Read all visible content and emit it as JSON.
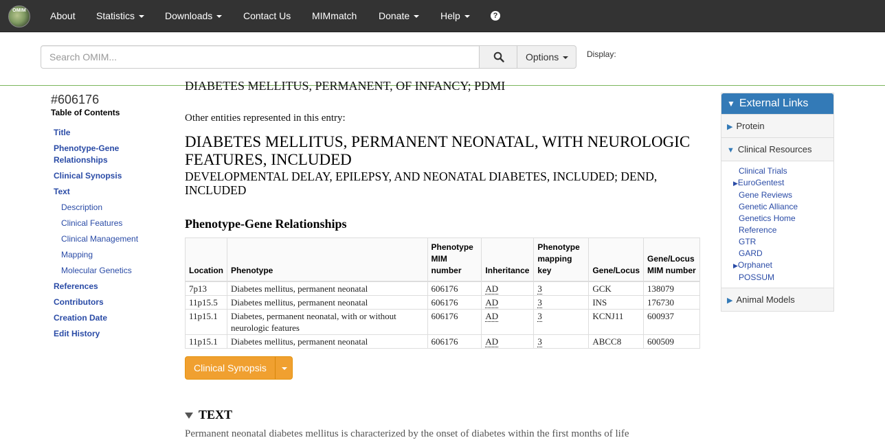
{
  "navbar": {
    "logo_text": "OMIM",
    "items": [
      {
        "label": "About",
        "dropdown": false
      },
      {
        "label": "Statistics",
        "dropdown": true
      },
      {
        "label": "Downloads",
        "dropdown": true
      },
      {
        "label": "Contact Us",
        "dropdown": false
      },
      {
        "label": "MIMmatch",
        "dropdown": false
      },
      {
        "label": "Donate",
        "dropdown": true
      },
      {
        "label": "Help",
        "dropdown": true
      }
    ],
    "help_icon": "question-circle-icon"
  },
  "search": {
    "placeholder": "Search OMIM...",
    "search_icon": "magnifier-icon",
    "options_label": "Options",
    "display_label": "Display:"
  },
  "toc": {
    "entry_number": "#606176",
    "title": "Table of Contents",
    "items": [
      {
        "label": "Title",
        "sub": false
      },
      {
        "label": "Phenotype-Gene Relationships",
        "sub": false
      },
      {
        "label": "Clinical Synopsis",
        "sub": false
      },
      {
        "label": "Text",
        "sub": false
      },
      {
        "label": "Description",
        "sub": true
      },
      {
        "label": "Clinical Features",
        "sub": true
      },
      {
        "label": "Clinical Management",
        "sub": true
      },
      {
        "label": "Mapping",
        "sub": true
      },
      {
        "label": "Molecular Genetics",
        "sub": true
      },
      {
        "label": "References",
        "sub": false
      },
      {
        "label": "Contributors",
        "sub": false
      },
      {
        "label": "Creation Date",
        "sub": false
      },
      {
        "label": "Edit History",
        "sub": false
      }
    ]
  },
  "main": {
    "cut_title": "DIABETES MELLITUS, PERMANENT, OF INFANCY; PDMI",
    "other_entities": "Other entities represented in this entry:",
    "included_title": "DIABETES MELLITUS, PERMANENT NEONATAL, WITH NEUROLOGIC FEATURES, INCLUDED",
    "included_subtitle": "DEVELOPMENTAL DELAY, EPILEPSY, AND NEONATAL DIABETES, INCLUDED; DEND, INCLUDED",
    "pg_heading": "Phenotype-Gene Relationships",
    "table": {
      "headers": [
        "Location",
        "Phenotype",
        "Phenotype MIM number",
        "Inheritance",
        "Phenotype mapping key",
        "Gene/Locus",
        "Gene/Locus MIM number"
      ],
      "rows": [
        [
          "7p13",
          "Diabetes mellitus, permanent neonatal",
          "606176",
          "AD",
          "3",
          "GCK",
          "138079"
        ],
        [
          "11p15.5",
          "Diabetes mellitus, permanent neonatal",
          "606176",
          "AD",
          "3",
          "INS",
          "176730"
        ],
        [
          "11p15.1",
          "Diabetes, permanent neonatal, with or without neurologic features",
          "606176",
          "AD",
          "3",
          "KCNJ11",
          "600937"
        ],
        [
          "11p15.1",
          "Diabetes mellitus, permanent neonatal",
          "606176",
          "AD",
          "3",
          "ABCC8",
          "600509"
        ]
      ]
    },
    "clinical_synopsis_button": "Clinical Synopsis",
    "text_heading": "TEXT",
    "bottom_cut": "Permanent neonatal diabetes mellitus is characterized by the onset of diabetes within the first months of life"
  },
  "external_links": {
    "header": "External Links",
    "sections": {
      "protein": "Protein",
      "clinical": "Clinical Resources",
      "animal": "Animal Models"
    },
    "clinical_links": [
      {
        "label": "Clinical Trials",
        "arrow": false
      },
      {
        "label": "EuroGentest",
        "arrow": true
      },
      {
        "label": "Gene Reviews",
        "arrow": false
      },
      {
        "label": "Genetic Alliance",
        "arrow": false
      },
      {
        "label": "Genetics Home",
        "arrow": false
      },
      {
        "label": "Reference",
        "arrow": false
      },
      {
        "label": "GTR",
        "arrow": false
      },
      {
        "label": "GARD",
        "arrow": false
      },
      {
        "label": "Orphanet",
        "arrow": true
      },
      {
        "label": "POSSUM",
        "arrow": false
      }
    ]
  },
  "colors": {
    "navbar": "#333333",
    "link": "#2a4ba6",
    "accent_blue": "#337ab7",
    "button_orange": "#f0a030",
    "divider_green": "#7ab55c"
  }
}
